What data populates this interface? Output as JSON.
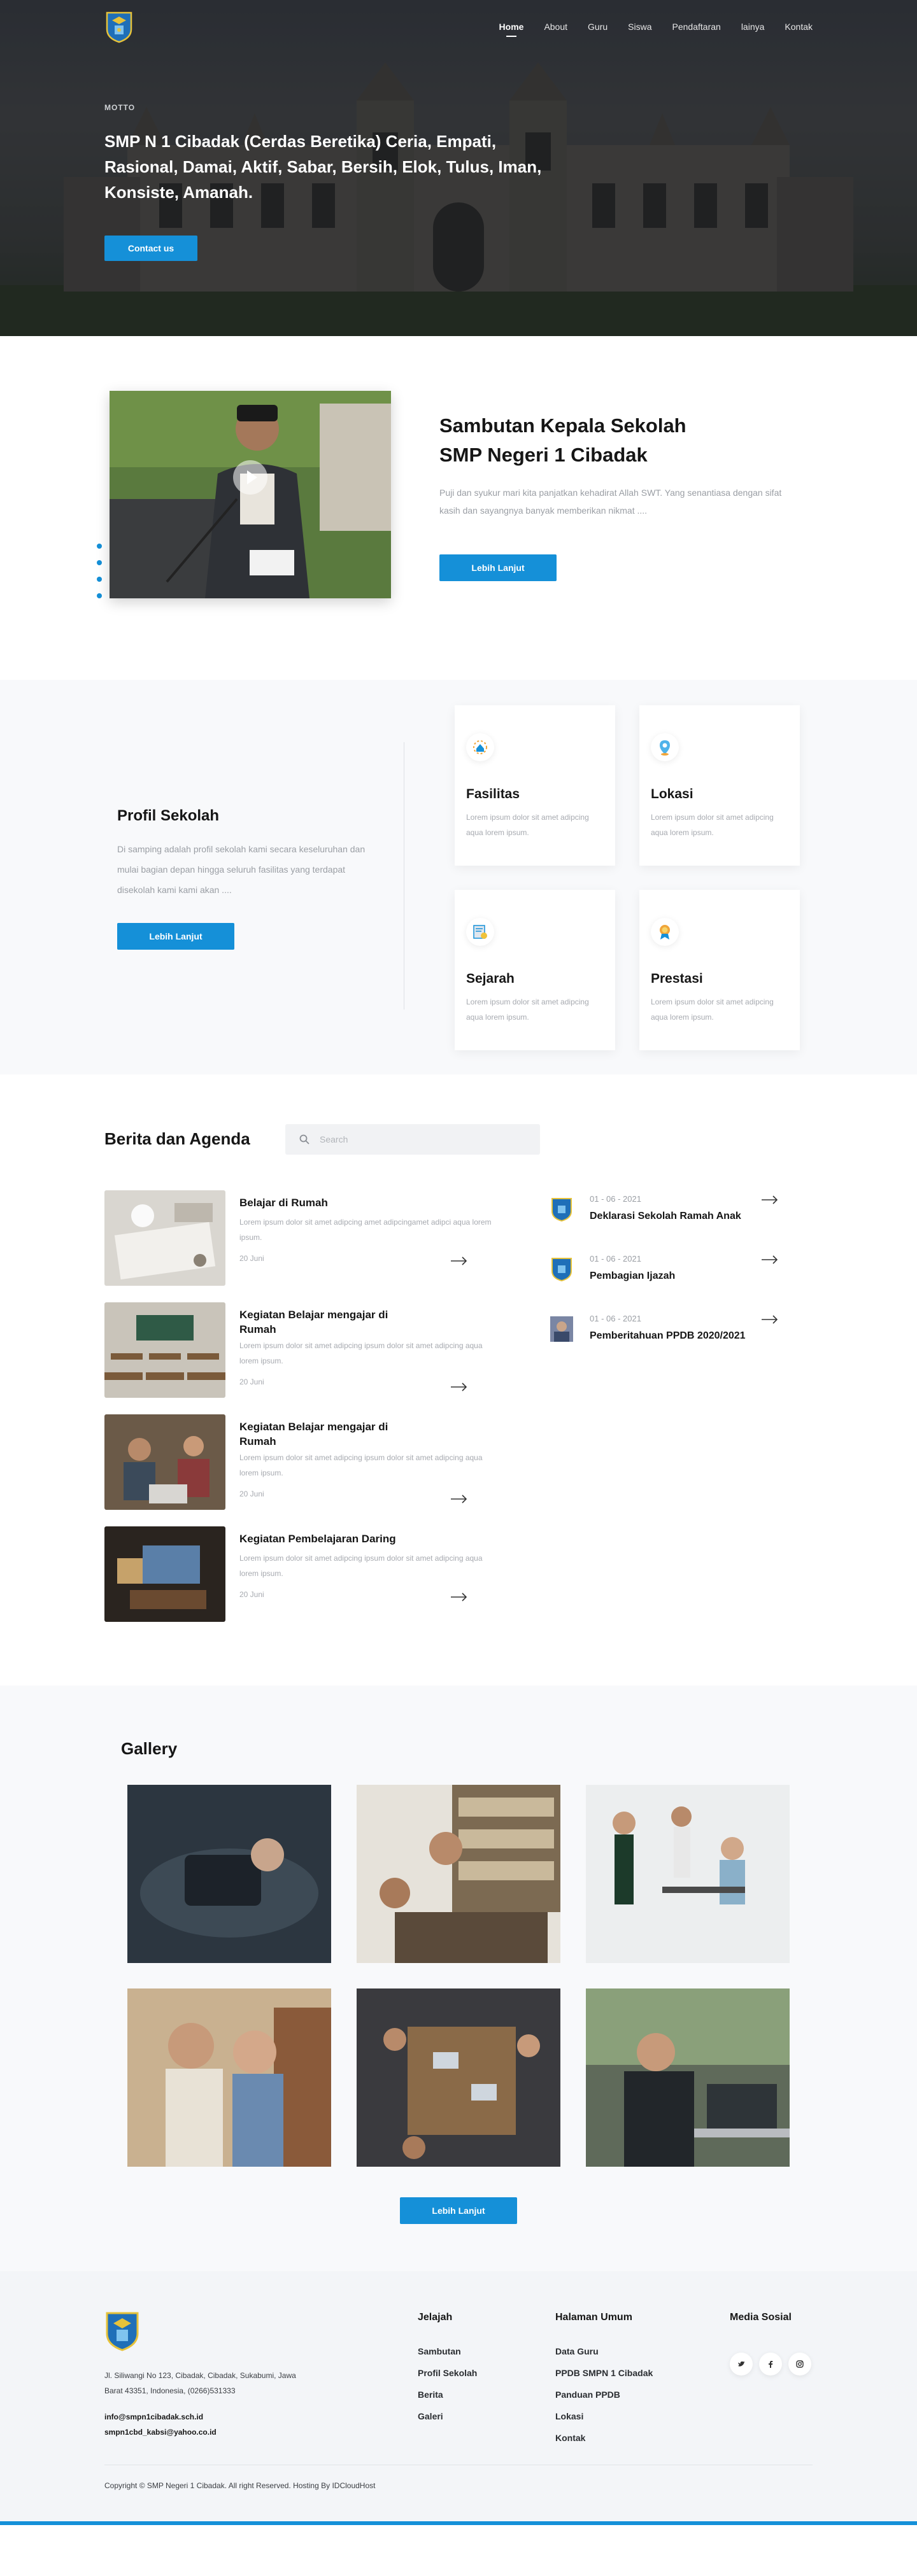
{
  "nav": {
    "items": [
      "Home",
      "About",
      "Guru",
      "Siswa",
      "Pendaftaran",
      "lainya",
      "Kontak"
    ],
    "active_index": 0
  },
  "hero": {
    "label": "MOTTO",
    "motto": "SMP N 1 Cibadak (Cerdas Beretika) Ceria, Empati, Rasional, Damai, Aktif, Sabar, Bersih, Elok, Tulus, Iman, Konsiste, Amanah.",
    "button": "Contact us"
  },
  "sambutan": {
    "title_line1": "Sambutan Kepala Sekolah",
    "title_line2": "SMP Negeri 1 Cibadak",
    "text": "Puji dan syukur mari kita panjatkan kehadirat Allah SWT. Yang senantiasa dengan sifat kasih dan sayangnya banyak memberikan nikmat ....",
    "button": "Lebih Lanjut"
  },
  "profil": {
    "title": "Profil Sekolah",
    "text": "Di samping adalah profil sekolah kami secara keseluruhan dan mulai bagian depan hingga seluruh fasilitas yang terdapat disekolah kami kami akan ....",
    "button": "Lebih Lanjut",
    "cards": [
      {
        "title": "Fasilitas",
        "text": "Lorem ipsum dolor sit amet adipcing aqua lorem ipsum.",
        "icon": "building-icon"
      },
      {
        "title": "Lokasi",
        "text": "Lorem ipsum dolor sit amet adipcing aqua lorem ipsum.",
        "icon": "location-pin-icon"
      },
      {
        "title": "Sejarah",
        "text": "Lorem ipsum dolor sit amet adipcing aqua lorem ipsum.",
        "icon": "certificate-icon"
      },
      {
        "title": "Prestasi",
        "text": "Lorem ipsum dolor sit amet adipcing aqua lorem ipsum.",
        "icon": "medal-icon"
      }
    ]
  },
  "berita": {
    "title": "Berita dan Agenda",
    "search_placeholder": "Search",
    "news": [
      {
        "title": "Belajar di Rumah",
        "text": "Lorem ipsum dolor sit amet adipcing amet adipcingamet adipci aqua lorem ipsum.",
        "date": "20 Juni"
      },
      {
        "title": "Kegiatan Belajar mengajar di Rumah",
        "text": "Lorem ipsum dolor sit amet adipcing ipsum dolor sit amet adipcing aqua lorem ipsum.",
        "date": "20 Juni"
      },
      {
        "title": "Kegiatan Belajar mengajar di Rumah",
        "text": "Lorem ipsum dolor sit amet adipcing ipsum dolor sit amet adipcing aqua lorem ipsum.",
        "date": "20 Juni"
      },
      {
        "title": "Kegiatan Pembelajaran Daring",
        "text": "Lorem ipsum dolor sit amet adipcing ipsum dolor sit amet adipcing aqua lorem ipsum.",
        "date": "20 Juni"
      }
    ],
    "agenda": [
      {
        "date": "01 - 06 - 2021",
        "title": "Deklarasi Sekolah Ramah Anak"
      },
      {
        "date": "01 - 06 - 2021",
        "title": "Pembagian Ijazah"
      },
      {
        "date": "01 - 06 - 2021",
        "title": "Pemberitahuan PPDB 2020/2021"
      }
    ]
  },
  "gallery": {
    "title": "Gallery",
    "button": "Lebih Lanjut"
  },
  "footer": {
    "address": "Jl. Siliwangi No 123, Cibadak, Cibadak, Sukabumi, Jawa Barat 43351, Indonesia, (0266)531333",
    "email1": "info@smpn1cibadak.sch.id",
    "email2": "smpn1cbd_kabsi@yahoo.co.id",
    "col1_title": "Jelajah",
    "col1_links": [
      "Sambutan",
      "Profil Sekolah",
      "Berita",
      "Galeri"
    ],
    "col2_title": "Halaman Umum",
    "col2_links": [
      "Data Guru",
      "PPDB SMPN 1 Cibadak",
      "Panduan PPDB",
      "Lokasi",
      "Kontak"
    ],
    "col3_title": "Media Sosial",
    "social": [
      "twitter-icon",
      "facebook-icon",
      "instagram-icon"
    ],
    "copyright": "Copyright © SMP Negeri 1 Cibadak. All right Reserved. Hosting By IDCloudHost"
  },
  "colors": {
    "accent": "#1590d8",
    "text": "#161616",
    "muted": "#9a9ea4",
    "soft_bg": "#f8f9fb"
  }
}
